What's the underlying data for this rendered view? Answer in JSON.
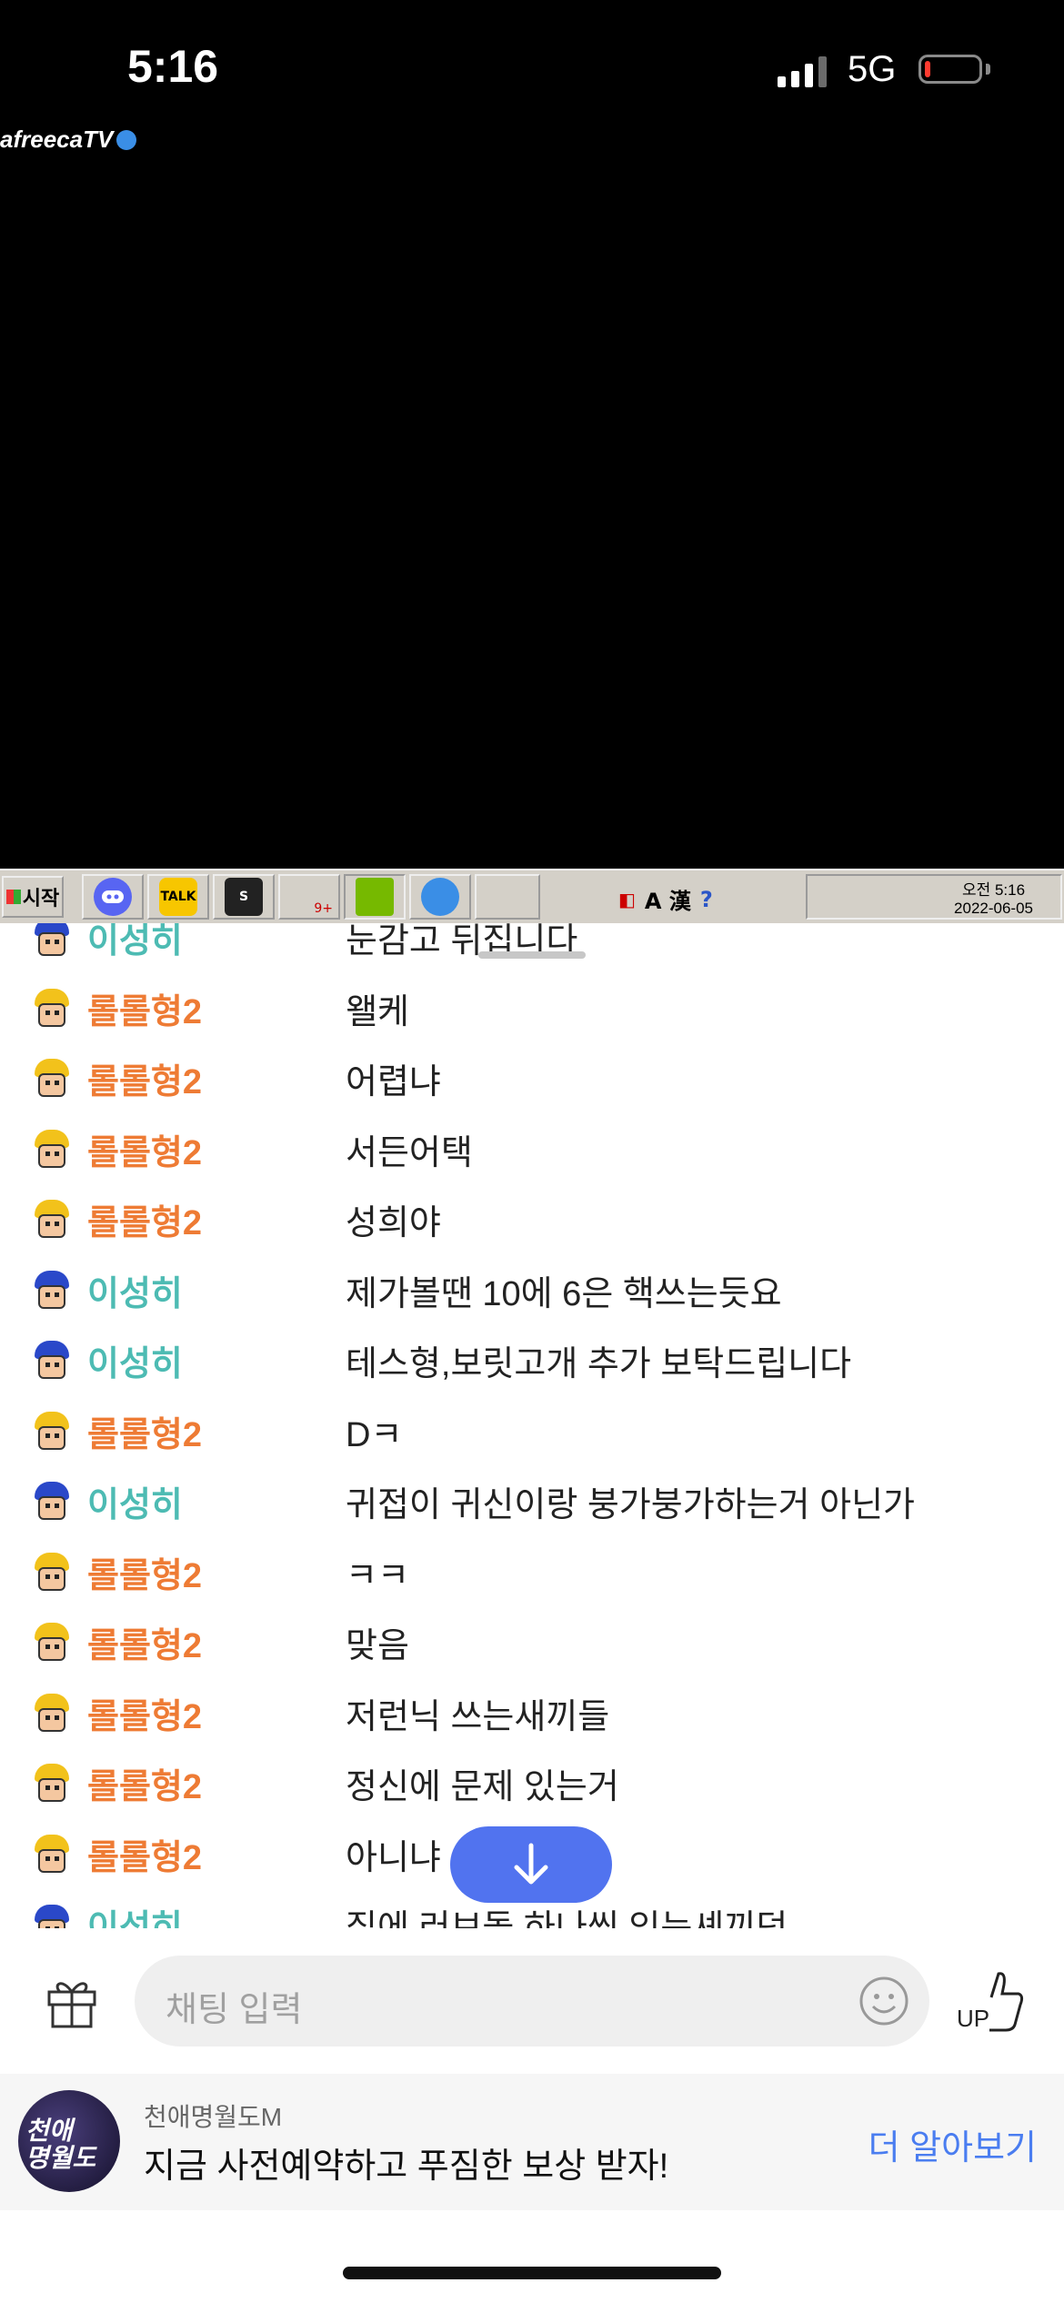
{
  "status_bar": {
    "time": "5:16",
    "network": "5G",
    "battery_level": 0.1,
    "signal_bars_active": 3
  },
  "player": {
    "logo_text": "afreecaTV"
  },
  "taskbar": {
    "start_label": "시작",
    "tray_clock_line1": "오전 5:16",
    "tray_clock_line2": "2022-06-05",
    "tray_symbols": "A 漢",
    "badge": "9+",
    "talk_label": "TALK"
  },
  "chat": {
    "colors": {
      "rolrol": "#ee7b34",
      "leesung": "#4dbbb3"
    },
    "messages": [
      {
        "user": "이성히",
        "text": "눈감고 뒤집니다",
        "type": "leesung"
      },
      {
        "user": "롤롤형2",
        "text": "왤케",
        "type": "rolrol"
      },
      {
        "user": "롤롤형2",
        "text": "어렵냐",
        "type": "rolrol"
      },
      {
        "user": "롤롤형2",
        "text": "서든어택",
        "type": "rolrol"
      },
      {
        "user": "롤롤형2",
        "text": "성희야",
        "type": "rolrol"
      },
      {
        "user": "이성히",
        "text": "제가볼땐 10에 6은 핵쓰는듯요",
        "type": "leesung"
      },
      {
        "user": "이성히",
        "text": "테스형,보릿고개 추가 보탁드립니다",
        "type": "leesung"
      },
      {
        "user": "롤롤형2",
        "text": "Dㅋ",
        "type": "rolrol"
      },
      {
        "user": "이성히",
        "text": "귀접이 귀신이랑 붕가붕가하는거 아닌가",
        "type": "leesung"
      },
      {
        "user": "롤롤형2",
        "text": "ㅋㅋ",
        "type": "rolrol"
      },
      {
        "user": "롤롤형2",
        "text": "맞음",
        "type": "rolrol"
      },
      {
        "user": "롤롤형2",
        "text": "저런닉 쓰는새끼들",
        "type": "rolrol"
      },
      {
        "user": "롤롤형2",
        "text": "정신에 문제 있는거",
        "type": "rolrol"
      },
      {
        "user": "롤롤형2",
        "text": "아니냐",
        "type": "rolrol"
      },
      {
        "user": "이성히",
        "text": "집에 러브돌 하나씩 있는셰끼덕",
        "type": "leesung"
      }
    ]
  },
  "input": {
    "placeholder": "채팅 입력",
    "up_label": "UP"
  },
  "ad": {
    "brand": "천애명월도M",
    "text": "지금 사전예약하고 푸짐한 보상 받자!",
    "cta": "더 알아보기",
    "logo_text": "천애\n명월도"
  }
}
